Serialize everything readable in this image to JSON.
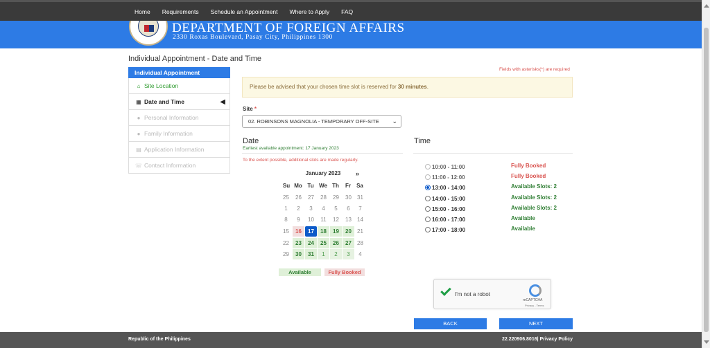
{
  "nav": {
    "items": [
      "Home",
      "Requirements",
      "Schedule an Appointment",
      "Where to Apply",
      "FAQ"
    ]
  },
  "banner": {
    "title": "DEPARTMENT OF FOREIGN AFFAIRS",
    "address": "2330 Roxas Boulevard, Pasay City, Philippines 1300"
  },
  "page": {
    "title": "Individual Appointment - Date and Time"
  },
  "sidebar": {
    "header": "Individual Appointment",
    "items": [
      {
        "label": "Site Location",
        "icon": "home-icon",
        "state": "done"
      },
      {
        "label": "Date and Time",
        "icon": "calendar-icon",
        "state": "active"
      },
      {
        "label": "Personal Information",
        "icon": "user-icon",
        "state": "disabled"
      },
      {
        "label": "Family Information",
        "icon": "users-icon",
        "state": "disabled"
      },
      {
        "label": "Application Information",
        "icon": "list-icon",
        "state": "disabled"
      },
      {
        "label": "Contact Information",
        "icon": "phone-icon",
        "state": "disabled"
      }
    ]
  },
  "form": {
    "required_note": "Fields with asterisks(*) are required",
    "notice_prefix": "Please be advised that your chosen time slot is reserved for",
    "notice_bold": "30 minutes",
    "notice_suffix": ".",
    "site_label": "Site",
    "site_value": "02. ROBINSONS MAGNOLIA - TEMPORARY OFF-SITE"
  },
  "date": {
    "heading": "Date",
    "earliest": "Earliest available appointment: 17 January 2023",
    "extent": "To the extent possible, additional slots are made regularly.",
    "month": "January 2023",
    "next": "»",
    "weekdays": [
      "Su",
      "Mo",
      "Tu",
      "We",
      "Th",
      "Fr",
      "Sa"
    ],
    "weeks": [
      [
        "25",
        "26",
        "27",
        "28",
        "29",
        "30",
        "31"
      ],
      [
        "1",
        "2",
        "3",
        "4",
        "5",
        "6",
        "7"
      ],
      [
        "8",
        "9",
        "10",
        "11",
        "12",
        "13",
        "14"
      ],
      [
        "15",
        "16",
        "17",
        "18",
        "19",
        "20",
        "21"
      ],
      [
        "22",
        "23",
        "24",
        "25",
        "26",
        "27",
        "28"
      ],
      [
        "29",
        "30",
        "31",
        "1",
        "2",
        "3",
        "4"
      ]
    ],
    "legend_available": "Available",
    "legend_full": "Fully Booked"
  },
  "time": {
    "heading": "Time",
    "slots": [
      {
        "label": "10:00 - 11:00",
        "status": "Fully Booked",
        "kind": "full"
      },
      {
        "label": "11:00 - 12:00",
        "status": "Fully Booked",
        "kind": "full"
      },
      {
        "label": "13:00 - 14:00",
        "status": "Available Slots: 2",
        "kind": "avail",
        "checked": true
      },
      {
        "label": "14:00 - 15:00",
        "status": "Available Slots: 2",
        "kind": "avail"
      },
      {
        "label": "15:00 - 16:00",
        "status": "Available Slots: 2",
        "kind": "avail"
      },
      {
        "label": "16:00 - 17:00",
        "status": "Available",
        "kind": "avail"
      },
      {
        "label": "17:00 - 18:00",
        "status": "Available",
        "kind": "avail"
      }
    ]
  },
  "captcha": {
    "label": "I'm not a robot",
    "brand": "reCAPTCHA",
    "terms": "Privacy - Terms"
  },
  "buttons": {
    "back": "BACK",
    "next": "NEXT"
  },
  "footer": {
    "left": "Republic of the Philippines",
    "right": "22.220906.8016| Privacy Policy"
  },
  "colors": {
    "brand_blue": "#2d7be5",
    "nav_bg": "#3a3a3a",
    "footer_bg": "#555555",
    "available_green": "#2e7d32",
    "full_red": "#d9534f",
    "selected_blue": "#0d5bc9"
  }
}
